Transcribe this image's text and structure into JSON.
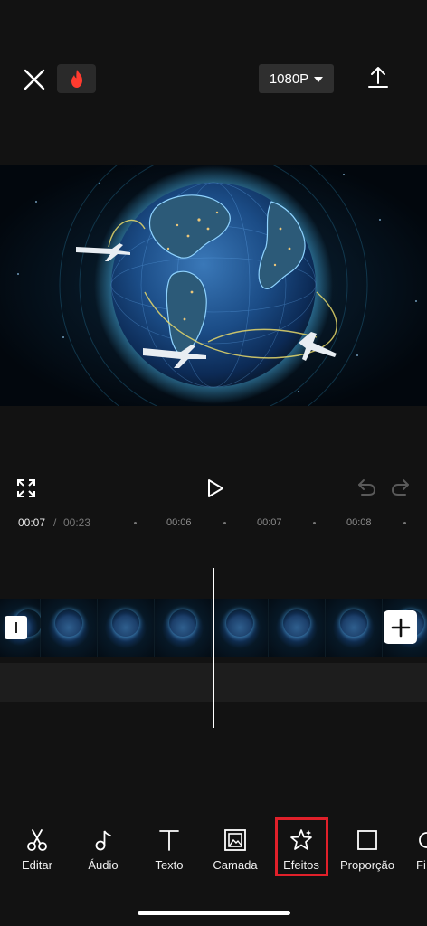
{
  "topbar": {
    "resolution_label": "1080P",
    "icons": {
      "close": "close-icon",
      "hot": "fire-icon",
      "export": "export-icon"
    }
  },
  "player": {
    "icons": {
      "fullscreen": "fullscreen-icon",
      "play": "play-icon",
      "undo": "undo-icon",
      "redo": "redo-icon"
    }
  },
  "timeline": {
    "current_time": "00:07",
    "separator": "/",
    "total_time": "00:23",
    "ticks": [
      "00:06",
      "00:07",
      "00:08"
    ]
  },
  "toolbar": {
    "items": [
      {
        "label": "Editar",
        "icon": "scissors-icon"
      },
      {
        "label": "Áudio",
        "icon": "music-note-icon"
      },
      {
        "label": "Texto",
        "icon": "text-icon"
      },
      {
        "label": "Camada",
        "icon": "overlay-icon"
      },
      {
        "label": "Efeitos",
        "icon": "effects-star-icon",
        "highlighted": true
      },
      {
        "label": "Proporção",
        "icon": "ratio-icon"
      },
      {
        "label": "Fi",
        "icon": "filter-icon"
      }
    ],
    "highlight_color": "#e0202a"
  },
  "colors": {
    "background": "#121212",
    "accent_glow": "#5ec7ff"
  }
}
